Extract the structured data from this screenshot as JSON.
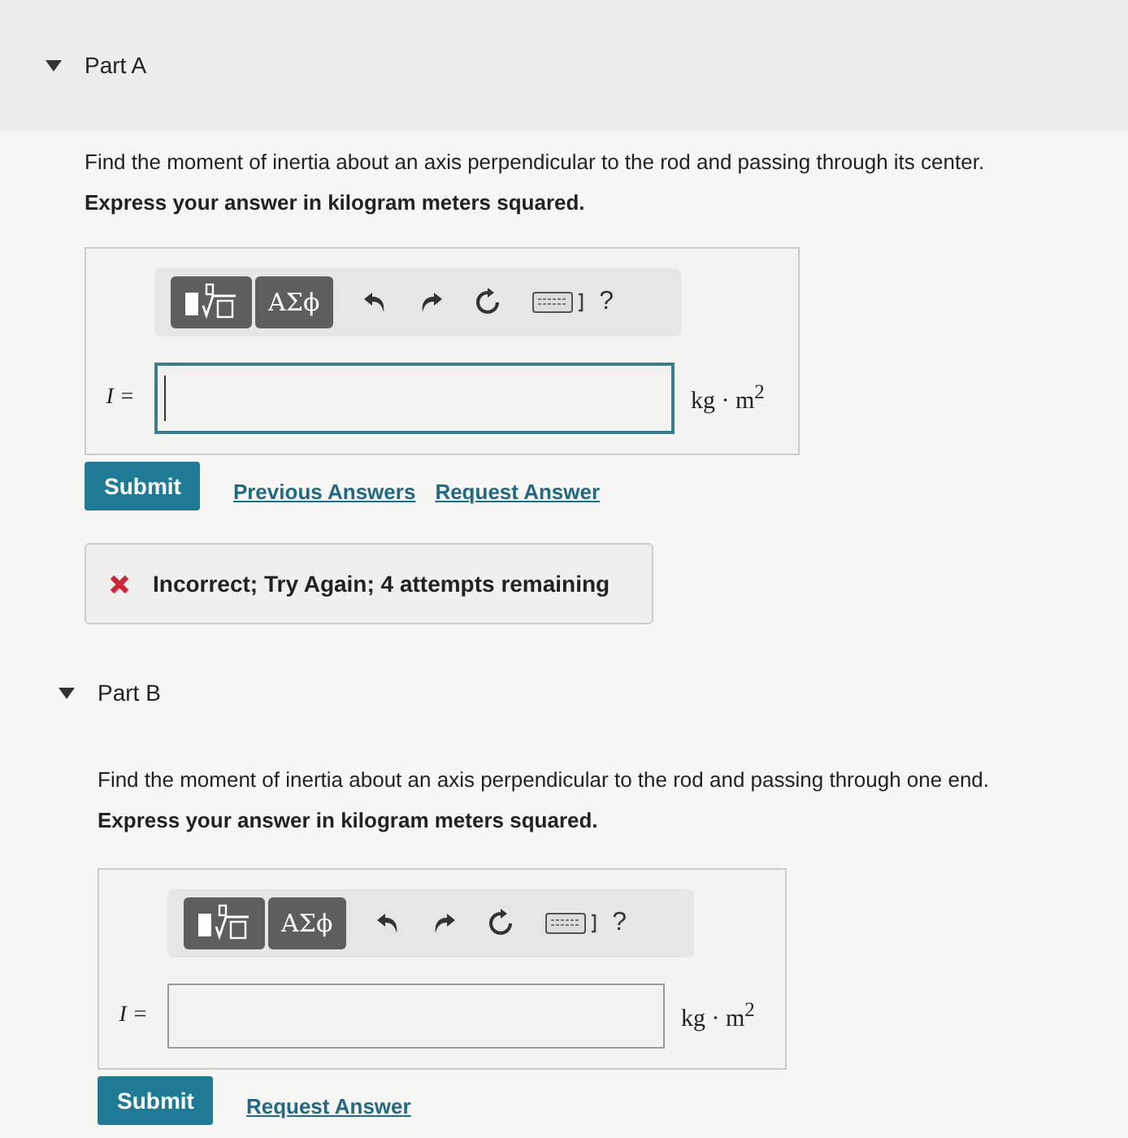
{
  "parts": [
    {
      "title": "Part A",
      "expanded": true,
      "question": "Find the moment of inertia about an axis perpendicular to the rod and passing through its center.",
      "instruction": "Express your answer in kilogram meters squared.",
      "toolbar": {
        "symbols": "ΑΣϕ",
        "help": "?"
      },
      "variable": "I =",
      "unit": "kg · m$^{2}$",
      "focused": true,
      "submit": "Submit",
      "links": [
        "Previous Answers",
        "Request Answer"
      ],
      "feedback": {
        "kind": "incorrect",
        "text": "Incorrect; Try Again; 4 attempts remaining"
      }
    },
    {
      "title": "Part B",
      "expanded": true,
      "question": "Find the moment of inertia about an axis perpendicular to the rod and passing through one end.",
      "instruction": "Express your answer in kilogram meters squared.",
      "toolbar": {
        "symbols": "ΑΣϕ",
        "help": "?"
      },
      "variable": "I =",
      "unit": "kg · m$^{2}$",
      "focused": false,
      "submit": "Submit",
      "links": [
        "Request Answer"
      ]
    }
  ]
}
